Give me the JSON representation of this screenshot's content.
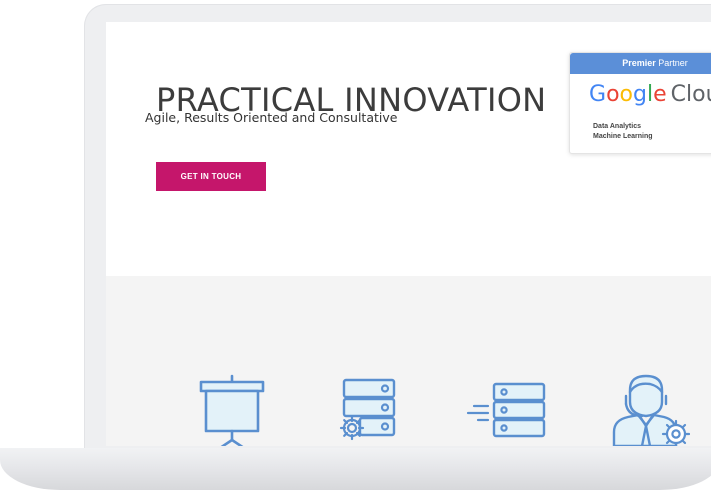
{
  "hero": {
    "title": "PRACTICAL INNOVATION",
    "subtitle": "Agile, Results Oriented and Consultative",
    "cta_label": "GET IN TOUCH"
  },
  "badge": {
    "header_bold": "Premier",
    "header_rest": " Partner",
    "brand": "Google",
    "product": "Cloud",
    "specializations": [
      "Data Analytics",
      "Machine Learning"
    ]
  },
  "services": {
    "icons": [
      "presentation-board-icon",
      "server-settings-icon",
      "fast-server-icon",
      "support-agent-icon"
    ]
  },
  "colors": {
    "accent": "#c5166b",
    "icon_stroke": "#5a8fcf",
    "icon_fill": "#e3f2f9",
    "badge_header": "#5b8fd8"
  }
}
